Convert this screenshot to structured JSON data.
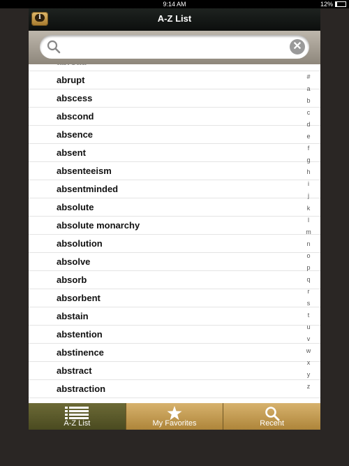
{
  "status": {
    "time": "9:14 AM",
    "battery": "12%",
    "battery_level": 0.12
  },
  "nav": {
    "title": "A-Z List",
    "info_icon": "info-bubble-icon"
  },
  "search": {
    "placeholder": "",
    "value": ""
  },
  "list": {
    "partial_top": "abroad",
    "items": [
      "abrupt",
      "abscess",
      "abscond",
      "absence",
      "absent",
      "absenteeism",
      "absentminded",
      "absolute",
      "absolute monarchy",
      "absolution",
      "absolve",
      "absorb",
      "absorbent",
      "abstain",
      "abstention",
      "abstinence",
      "abstract",
      "abstraction"
    ]
  },
  "index": [
    "#",
    "a",
    "b",
    "c",
    "d",
    "e",
    "f",
    "g",
    "h",
    "i",
    "j",
    "k",
    "l",
    "m",
    "n",
    "o",
    "p",
    "q",
    "r",
    "s",
    "t",
    "u",
    "v",
    "w",
    "x",
    "y",
    "z"
  ],
  "tabs": [
    {
      "label": "A-Z List",
      "icon": "list-icon",
      "selected": true
    },
    {
      "label": "My Favorites",
      "icon": "star-icon",
      "selected": false
    },
    {
      "label": "Recent",
      "icon": "search-icon",
      "selected": false
    }
  ],
  "colors": {
    "tab_gold": "#c49a4e",
    "tab_selected": "#5b5a2b",
    "nav_bg": "#121513"
  }
}
